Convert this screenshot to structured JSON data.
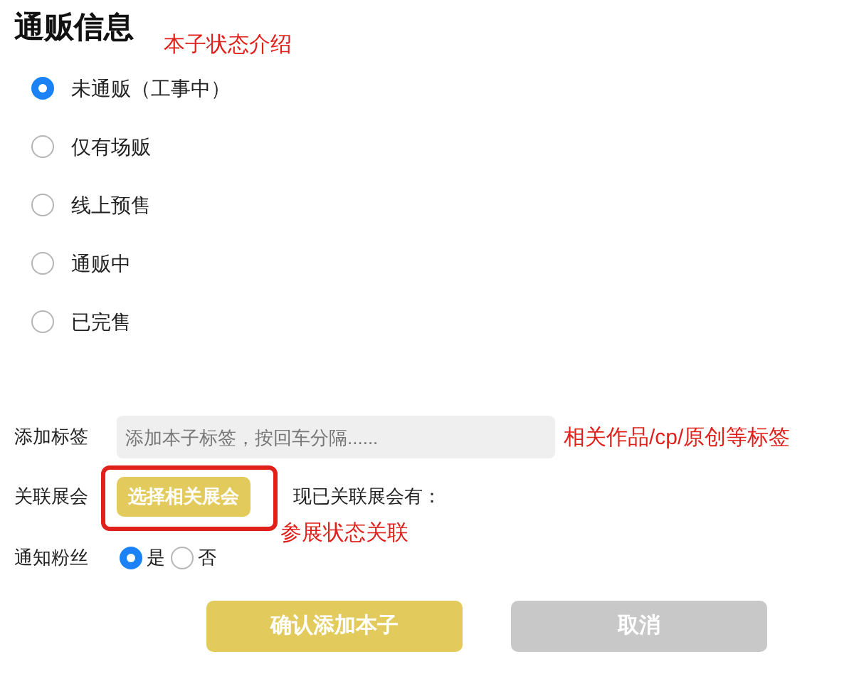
{
  "title": "通贩信息",
  "status_options": [
    {
      "label": "未通贩（工事中）",
      "selected": true
    },
    {
      "label": "仅有场贩",
      "selected": false
    },
    {
      "label": "线上预售",
      "selected": false
    },
    {
      "label": "通贩中",
      "selected": false
    },
    {
      "label": "已完售",
      "selected": false
    }
  ],
  "tags": {
    "label": "添加标签",
    "placeholder": "添加本子标签，按回车分隔......"
  },
  "event": {
    "label": "关联展会",
    "button": "选择相关展会",
    "linked_label": "现已关联展会有："
  },
  "notify": {
    "label": "通知粉丝",
    "options": [
      {
        "label": "是",
        "selected": true
      },
      {
        "label": "否",
        "selected": false
      }
    ]
  },
  "buttons": [
    {
      "label": "确认添加本子",
      "kind": "primary"
    },
    {
      "label": "取消",
      "kind": "secondary"
    }
  ],
  "annotations": [
    "本子状态介绍",
    "相关作品/cp/原创等标签",
    "参展状态关联"
  ]
}
